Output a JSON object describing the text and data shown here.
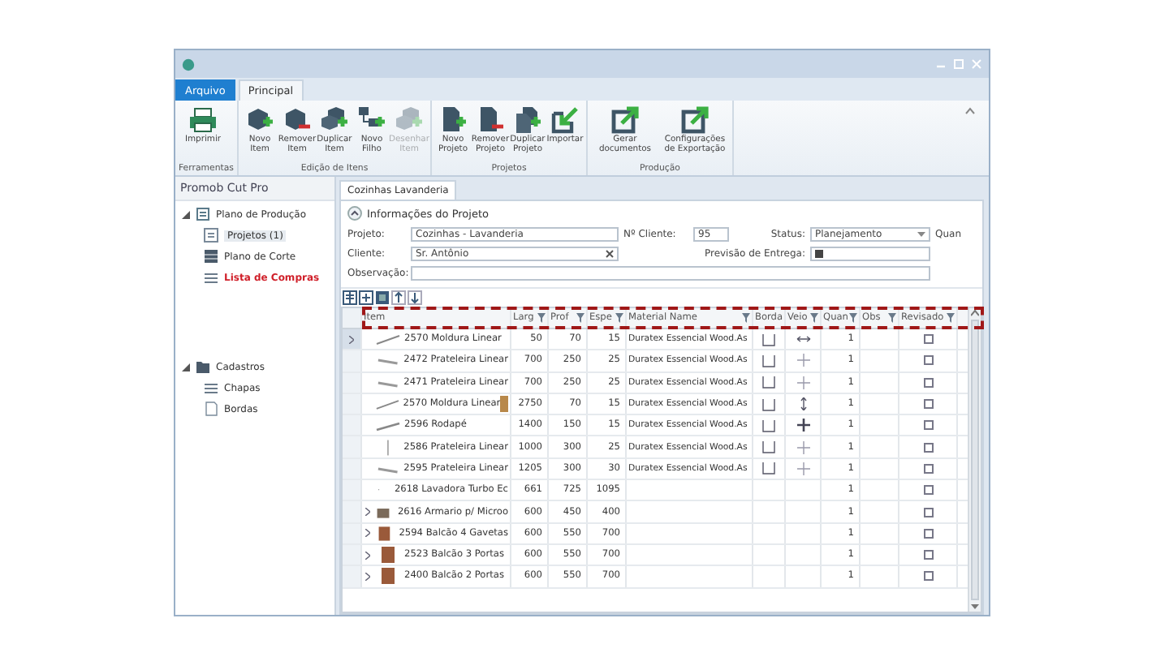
{
  "menu_tabs": [
    {
      "label": "Arquivo",
      "selected": true
    },
    {
      "label": "Principal",
      "selected": false
    }
  ],
  "ribbon_groups": [
    {
      "label": "Ferramentas",
      "buttons": [
        {
          "label": "Imprimir",
          "disabled": false
        }
      ]
    },
    {
      "label": "Edição de Itens",
      "buttons": [
        {
          "label": "Novo Item",
          "disabled": false
        },
        {
          "label": "Remover Item",
          "disabled": false
        },
        {
          "label": "Duplicar Item",
          "disabled": false
        },
        {
          "label": "Novo Filho",
          "disabled": false
        },
        {
          "label": "Desenhar Item",
          "disabled": true
        }
      ]
    },
    {
      "label": "Projetos",
      "buttons": [
        {
          "label": "Novo Projeto",
          "disabled": false
        },
        {
          "label": "Remover Projeto",
          "disabled": false
        },
        {
          "label": "Duplicar Projeto",
          "disabled": false
        },
        {
          "label": "Importar",
          "disabled": false
        }
      ]
    },
    {
      "label": "Produção",
      "buttons": [
        {
          "label": "Gerar documentos",
          "disabled": false
        },
        {
          "label": "Configurações de Exportação",
          "disabled": false
        }
      ]
    }
  ],
  "sidebar": {
    "title": "Promob Cut Pro",
    "tree": [
      {
        "label": "Plano de Produção",
        "expanded": true,
        "children": [
          {
            "label": "Projetos (1)",
            "selected": true,
            "emphasis": false
          },
          {
            "label": "Plano de Corte",
            "selected": false,
            "emphasis": false
          },
          {
            "label": "Lista de Compras",
            "selected": false,
            "emphasis": true
          }
        ]
      },
      {
        "label": "Cadastros",
        "expanded": true,
        "children": [
          {
            "label": "Chapas",
            "selected": false,
            "emphasis": false
          },
          {
            "label": "Bordas",
            "selected": false,
            "emphasis": false
          }
        ]
      }
    ]
  },
  "document_tabs": [
    {
      "label": "Cozinhas Lavanderia",
      "selected": true
    }
  ],
  "project_info": {
    "title": "Informações do Projeto",
    "expanded": true,
    "fields": [
      {
        "label": "Projeto:",
        "value": "Cozinhas - Lavanderia",
        "kind": "text"
      },
      {
        "label": "Nº Cliente:",
        "value": "95",
        "kind": "text"
      },
      {
        "label": "Status:",
        "value": "Planejamento",
        "kind": "dropdown"
      },
      {
        "label": "Quan",
        "kind": "label"
      },
      {
        "label": "Cliente:",
        "value": "Sr. Antônio",
        "kind": "combo"
      },
      {
        "label": "Previsão de Entrega:",
        "kind": "date"
      },
      {
        "label": "Observação:",
        "kind": "text"
      }
    ]
  },
  "grid": {
    "header_highlighted": true,
    "columns": [
      {
        "label": "Item",
        "filter": false
      },
      {
        "label": "Larg",
        "filter": true
      },
      {
        "label": "Prof",
        "filter": true
      },
      {
        "label": "Espe",
        "filter": true
      },
      {
        "label": "Material Name",
        "filter": true
      },
      {
        "label": "Borda",
        "filter": false
      },
      {
        "label": "Veio",
        "filter": true
      },
      {
        "label": "Quan",
        "filter": true
      },
      {
        "label": "Obs",
        "filter": true
      },
      {
        "label": "Revisado",
        "filter": true
      }
    ],
    "rows": [
      {
        "current": true,
        "expandable": false,
        "item": "2570 Moldura Linear",
        "larg": "50",
        "prof": "70",
        "espe": "15",
        "material": "Duratex Essencial Wood.As",
        "borda": true,
        "veio": {
          "kind": "horizontal"
        },
        "quan": "1",
        "revisado": false
      },
      {
        "current": false,
        "expandable": false,
        "item": "2472 Prateleira Linear",
        "larg": "700",
        "prof": "250",
        "espe": "25",
        "material": "Duratex Essencial Wood.As",
        "borda": true,
        "veio": {
          "kind": "cross"
        },
        "quan": "1",
        "revisado": false
      },
      {
        "current": false,
        "expandable": false,
        "item": "2471 Prateleira Linear",
        "larg": "700",
        "prof": "250",
        "espe": "25",
        "material": "Duratex Essencial Wood.As",
        "borda": true,
        "veio": {
          "kind": "cross"
        },
        "quan": "1",
        "revisado": false
      },
      {
        "current": false,
        "expandable": false,
        "item": "2570 Moldura Linear",
        "color": "#b8884a",
        "larg": "2750",
        "prof": "70",
        "espe": "15",
        "material": "Duratex Essencial Wood.As",
        "borda": true,
        "veio": {
          "kind": "vertical"
        },
        "quan": "1",
        "revisado": false
      },
      {
        "current": false,
        "expandable": false,
        "item": "2596 Rodapé",
        "larg": "1400",
        "prof": "150",
        "espe": "15",
        "material": "Duratex Essencial Wood.As",
        "borda": true,
        "veio": {
          "kind": "bold-cross"
        },
        "quan": "1",
        "revisado": false
      },
      {
        "current": false,
        "expandable": false,
        "item": "2586 Prateleira Linear",
        "larg": "1000",
        "prof": "300",
        "espe": "25",
        "material": "Duratex Essencial Wood.As",
        "borda": true,
        "veio": {
          "kind": "cross"
        },
        "quan": "1",
        "revisado": false
      },
      {
        "current": false,
        "expandable": false,
        "item": "2595 Prateleira Linear",
        "larg": "1205",
        "prof": "300",
        "espe": "30",
        "material": "Duratex Essencial Wood.As",
        "borda": true,
        "veio": {
          "kind": "cross"
        },
        "quan": "1",
        "revisado": false
      },
      {
        "current": false,
        "expandable": false,
        "item": "2618 Lavadora Turbo Ec",
        "larg": "661",
        "prof": "725",
        "espe": "1095",
        "borda": false,
        "quan": "1",
        "revisado": false
      },
      {
        "current": false,
        "expandable": true,
        "item": "2616 Armario p/ Microo",
        "larg": "600",
        "prof": "450",
        "espe": "400",
        "borda": false,
        "quan": "1",
        "revisado": false
      },
      {
        "current": false,
        "expandable": true,
        "item": "2594 Balcão 4 Gavetas",
        "larg": "600",
        "prof": "550",
        "espe": "700",
        "borda": false,
        "quan": "1",
        "revisado": false
      },
      {
        "current": false,
        "expandable": true,
        "item": "2523 Balcão 3 Portas",
        "larg": "600",
        "prof": "550",
        "espe": "700",
        "borda": false,
        "quan": "1",
        "revisado": false
      },
      {
        "current": false,
        "expandable": true,
        "item": "2400 Balcão 2 Portas",
        "larg": "600",
        "prof": "550",
        "espe": "700",
        "borda": false,
        "quan": "1",
        "revisado": false
      }
    ]
  }
}
